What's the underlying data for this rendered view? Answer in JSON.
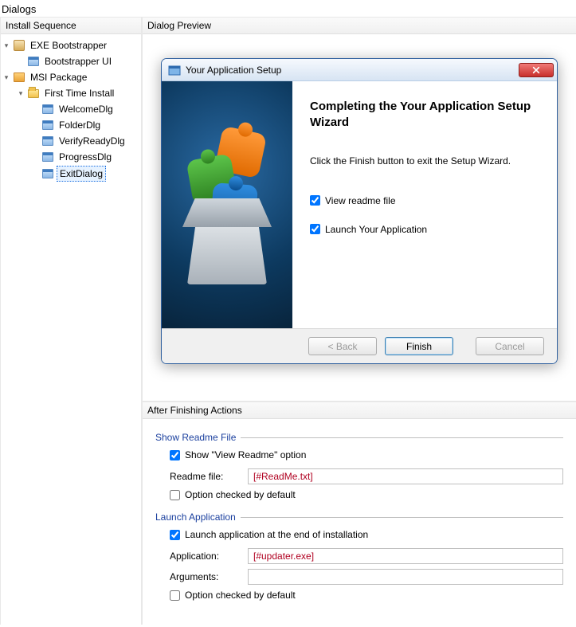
{
  "title": "Dialogs",
  "leftPanel": {
    "header": "Install Sequence"
  },
  "tree": {
    "exeBoot": "EXE Bootstrapper",
    "bootUI": "Bootstrapper UI",
    "msiPkg": "MSI Package",
    "firstTime": "First Time Install",
    "welcome": "WelcomeDlg",
    "folder": "FolderDlg",
    "verify": "VerifyReadyDlg",
    "progress": "ProgressDlg",
    "exit": "ExitDialog"
  },
  "preview": {
    "header": "Dialog Preview",
    "dlgTitle": "Your Application Setup",
    "heading": "Completing the Your Application Setup Wizard",
    "body": "Click the Finish button to exit the Setup Wizard.",
    "cbReadme": "View readme file",
    "cbLaunch": "Launch Your Application",
    "btnBack": "< Back",
    "btnFinish": "Finish",
    "btnCancel": "Cancel"
  },
  "actions": {
    "header": "After Finishing  Actions",
    "readme": {
      "title": "Show Readme File",
      "cbShow": "Show \"View Readme\" option",
      "labelFile": "Readme file:",
      "value": "[#ReadMe.txt]",
      "cbDefault": "Option checked by default"
    },
    "launch": {
      "title": "Launch Application",
      "cbLaunch": "Launch application at the end of installation",
      "labelApp": "Application:",
      "appValue": "[#updater.exe]",
      "labelArgs": "Arguments:",
      "argsValue": "",
      "cbDefault": "Option checked by default"
    }
  }
}
